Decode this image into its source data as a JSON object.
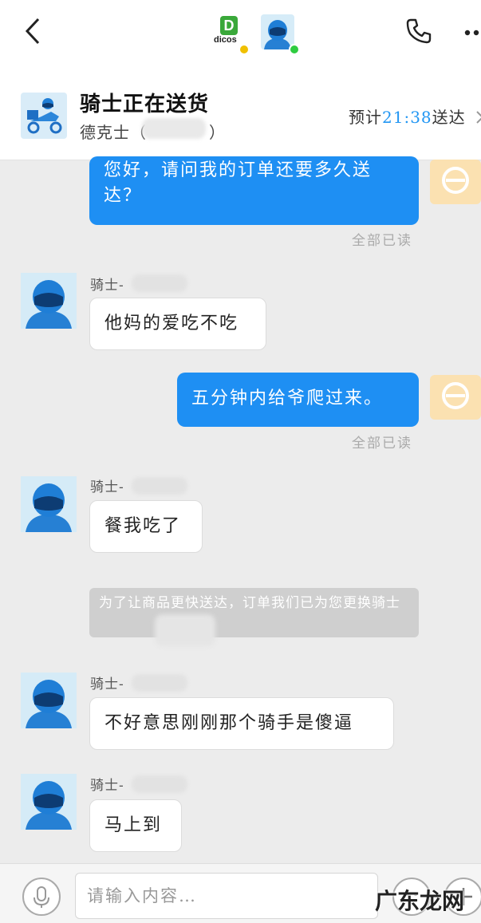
{
  "topbar": {
    "back_icon": "chevron-left-icon",
    "shop_logo_text": "dicos",
    "shop_logo_letter": "D",
    "phone_icon": "phone-icon",
    "more_icon": "more-dots-icon"
  },
  "order": {
    "status": "骑士正在送货",
    "shop_prefix": "德克士（",
    "shop_suffix": "）",
    "eta_prefix": "预计",
    "eta_time": "21:38",
    "eta_suffix": "送达"
  },
  "messages": {
    "m1_text": "您好，请问我的订单还要多久送达？",
    "m1_read": "全部已读",
    "m2_name": "骑士-",
    "m2_text": "他妈的爱吃不吃",
    "m3_text": "五分钟内给爷爬过来。",
    "m3_read": "全部已读",
    "m4_name": "骑士-",
    "m4_text": "餐我吃了",
    "notice": "为了让商品更快送达，订单我们已为您更换骑士",
    "m5_name": "骑士-",
    "m5_text": "不好意思刚刚那个骑手是傻逼",
    "m6_name": "骑士-",
    "m6_text": "马上到"
  },
  "input": {
    "placeholder": "请输入内容…"
  },
  "watermark": "广东龙网",
  "colors": {
    "accent": "#1e8ff3",
    "background": "#ececec",
    "online": "#2ecc40"
  }
}
